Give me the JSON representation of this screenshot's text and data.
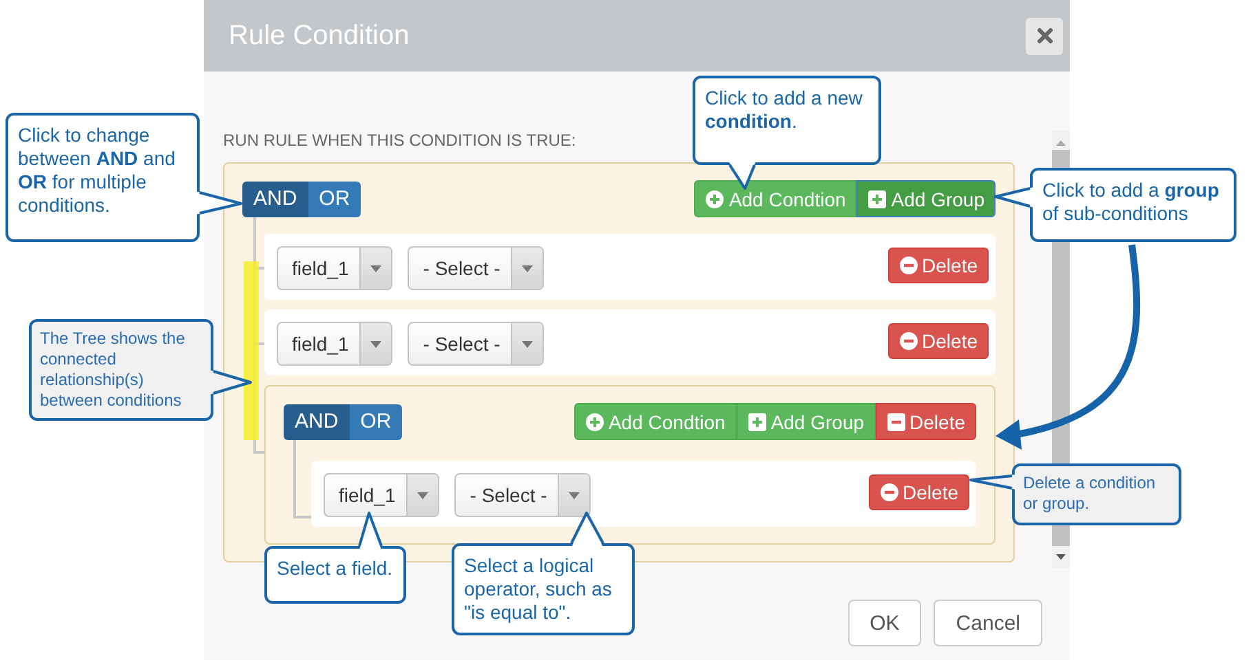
{
  "dialog": {
    "title": "Rule Condition",
    "heading": "RUN RULE WHEN THIS CONDITION IS TRUE:",
    "root_group": {
      "conjunctions": [
        {
          "label": "AND",
          "selected": true
        },
        {
          "label": "OR",
          "selected": false
        }
      ],
      "actions": [
        {
          "kind": "add-condition",
          "label": "Add Condtion",
          "highlighted": false
        },
        {
          "kind": "add-group",
          "label": "Add Group",
          "highlighted": true
        }
      ],
      "children": [
        {
          "kind": "rule",
          "field": "field_1",
          "operator": "- Select -",
          "delete_label": "Delete"
        },
        {
          "kind": "rule",
          "field": "field_1",
          "operator": "- Select -",
          "delete_label": "Delete"
        },
        {
          "kind": "group",
          "conjunctions": [
            {
              "label": "AND",
              "selected": true
            },
            {
              "label": "OR",
              "selected": false
            }
          ],
          "actions": [
            {
              "kind": "add-condition",
              "label": "Add Condtion",
              "highlighted": false
            },
            {
              "kind": "add-group",
              "label": "Add Group",
              "highlighted": false
            },
            {
              "kind": "delete",
              "label": "Delete",
              "highlighted": false
            }
          ],
          "children": [
            {
              "kind": "rule",
              "field": "field_1",
              "operator": "- Select -",
              "delete_label": "Delete"
            }
          ]
        }
      ]
    },
    "buttons": [
      {
        "label": "OK"
      },
      {
        "label": "Cancel"
      }
    ]
  },
  "callouts": [
    {
      "kind": "white",
      "text": "Click to add a new **condition**."
    },
    {
      "kind": "white",
      "text": "Click to change between **AND** and **OR** for multiple conditions."
    },
    {
      "kind": "white",
      "text": "Click to add a **group** of sub-conditions"
    },
    {
      "kind": "grey",
      "text": "The Tree shows the connected relationship(s) between conditions"
    },
    {
      "kind": "grey",
      "text": "Delete a condition or group."
    },
    {
      "kind": "white",
      "text": "Select a field."
    },
    {
      "kind": "white",
      "text": "Select a logical operator, such as \"is equal to\"."
    }
  ]
}
